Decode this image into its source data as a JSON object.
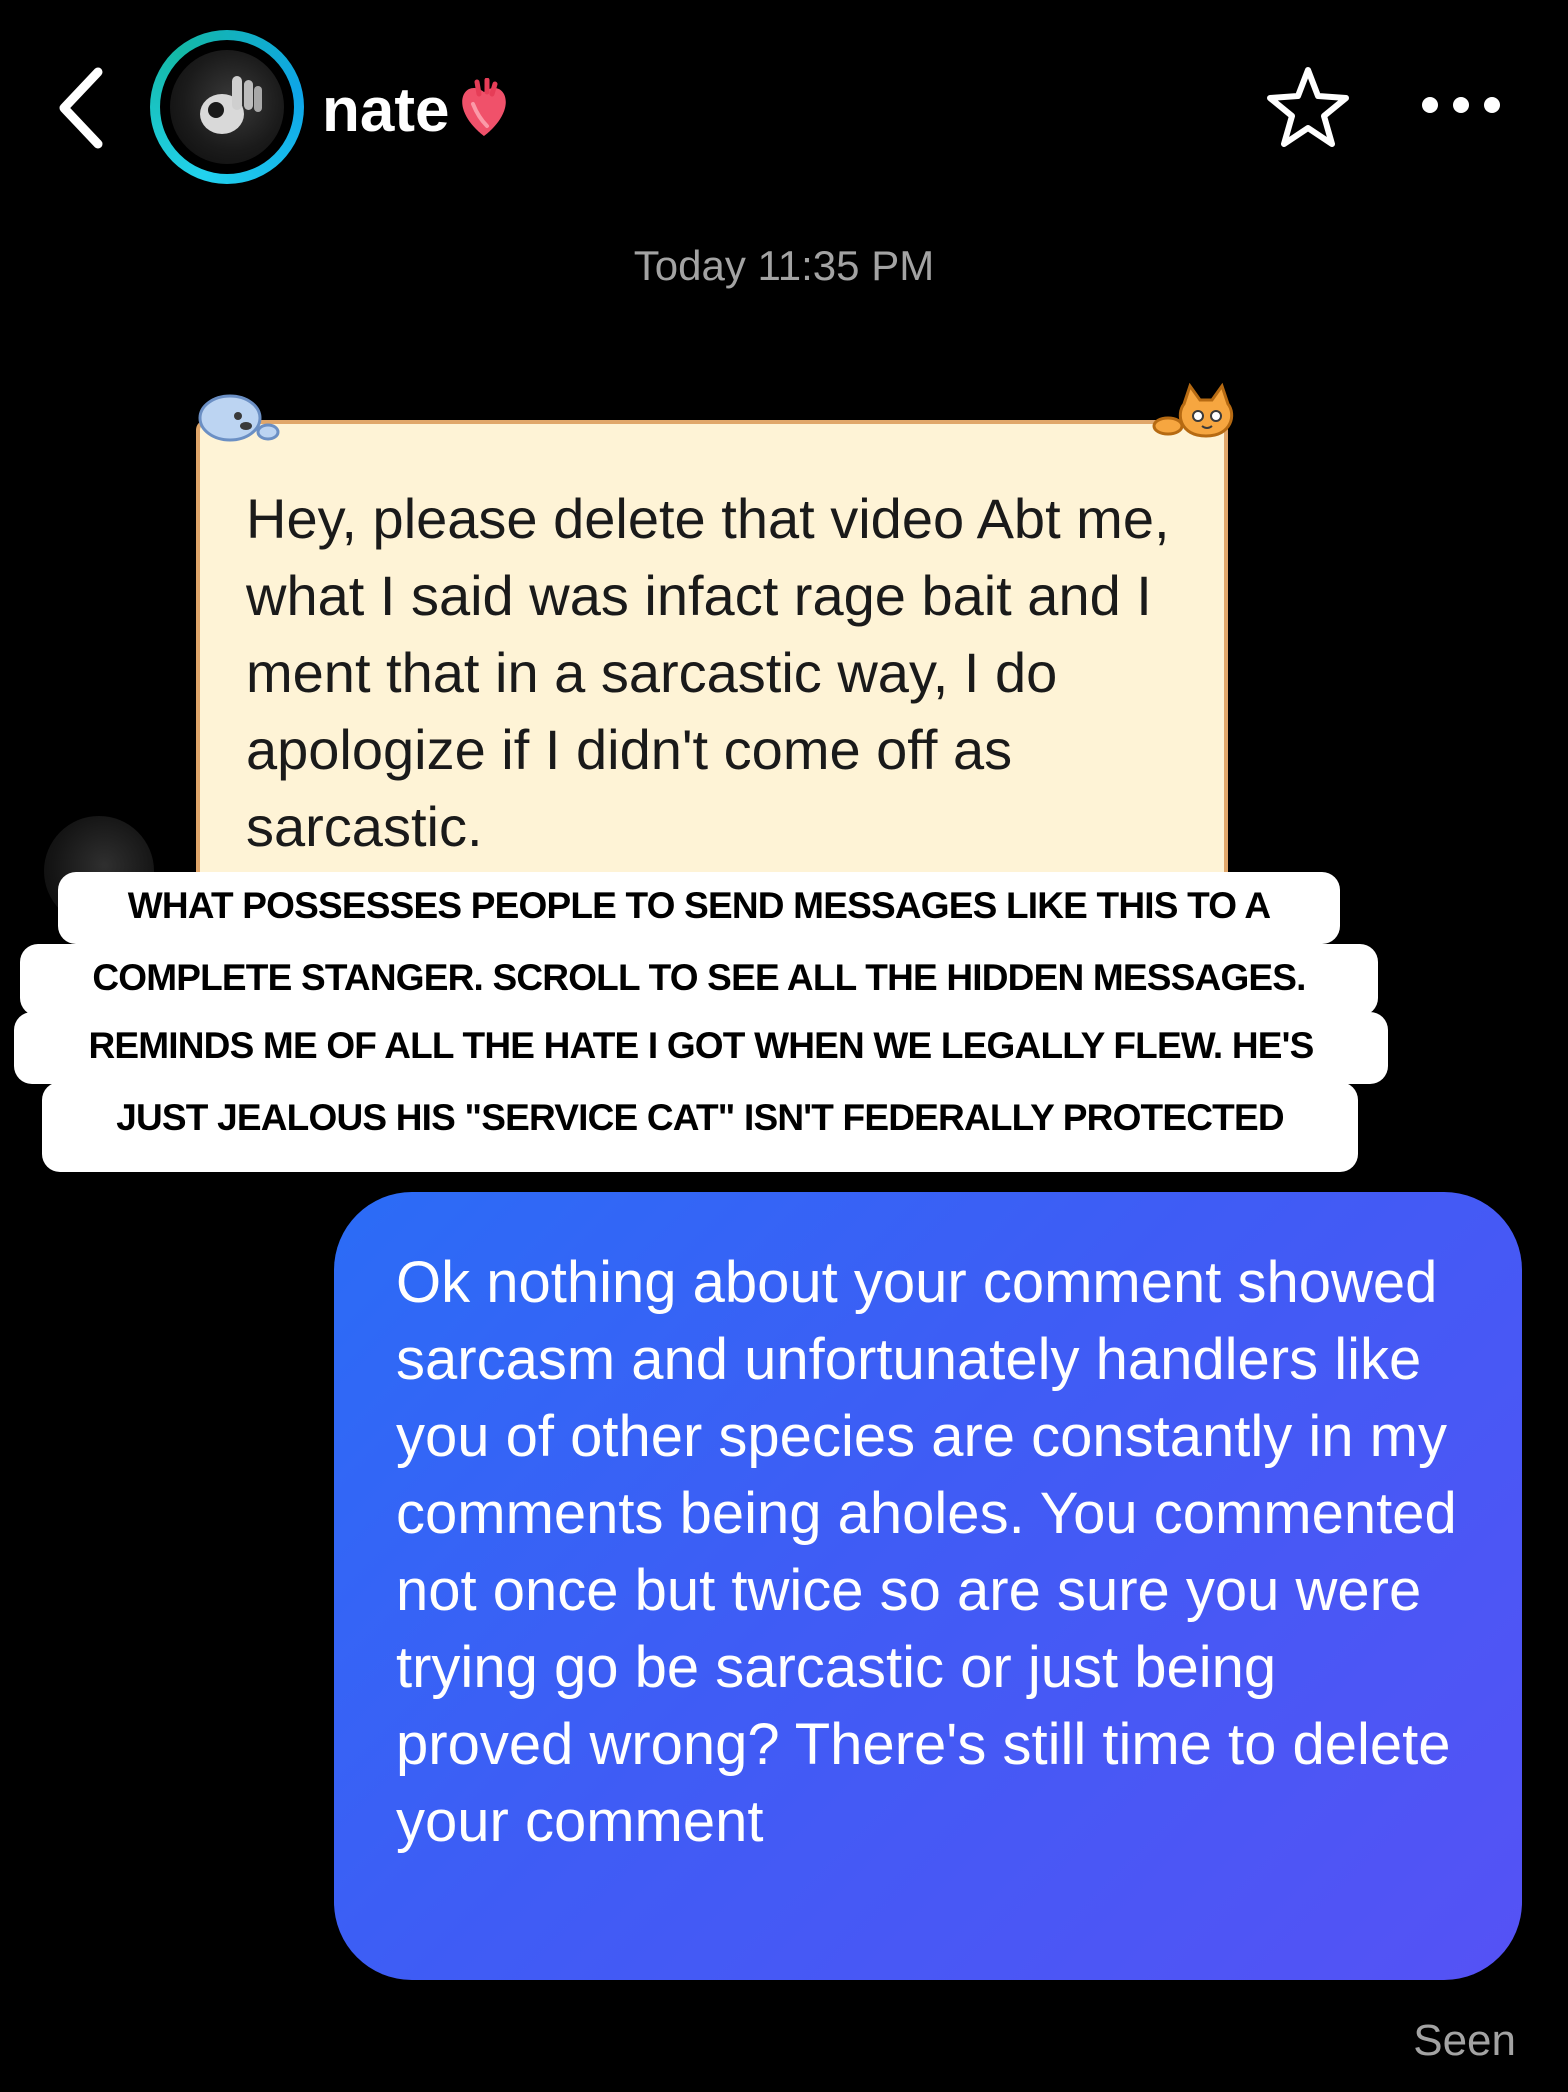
{
  "header": {
    "contact_name": "nate",
    "icons": {
      "back": "chevron-left-icon",
      "heart": "anatomical-heart-icon",
      "star": "star-outline-icon",
      "more": "ellipsis-icon"
    }
  },
  "thread": {
    "timestamp": "Today 11:35 PM",
    "received_message": "Hey, please delete that video Abt me, what I said was infact rage bait and I ment that in a sarcastic way, I do apologize if I didn't come off as sarcastic.",
    "sent_message": "Ok nothing about your comment showed sarcasm and unfortunately handlers like you of other species are constantly in my comments being aholes.  You commented not once but twice so are sure you were trying go be sarcastic or just being proved wrong?  There's still time to delete your comment",
    "status": "Seen"
  },
  "caption_overlay": {
    "lines": [
      "WHAT POSSESSES PEOPLE TO SEND MESSAGES LIKE THIS TO A",
      "COMPLETE STANGER. SCROLL TO SEE ALL THE HIDDEN MESSAGES.",
      "REMINDS ME OF ALL THE HATE I GOT WHEN WE LEGALLY FLEW. HE'S",
      "JUST JEALOUS HIS \"SERVICE CAT\" ISN'T FEDERALLY PROTECTED"
    ]
  },
  "colors": {
    "background": "#000000",
    "note_fill": "#fef3d6",
    "note_border": "#e0a66a",
    "sent_bubble_start": "#2b6cf6",
    "sent_bubble_end": "#5552f5",
    "avatar_ring": "#22d3ee",
    "muted_text": "#a3a3a3"
  }
}
